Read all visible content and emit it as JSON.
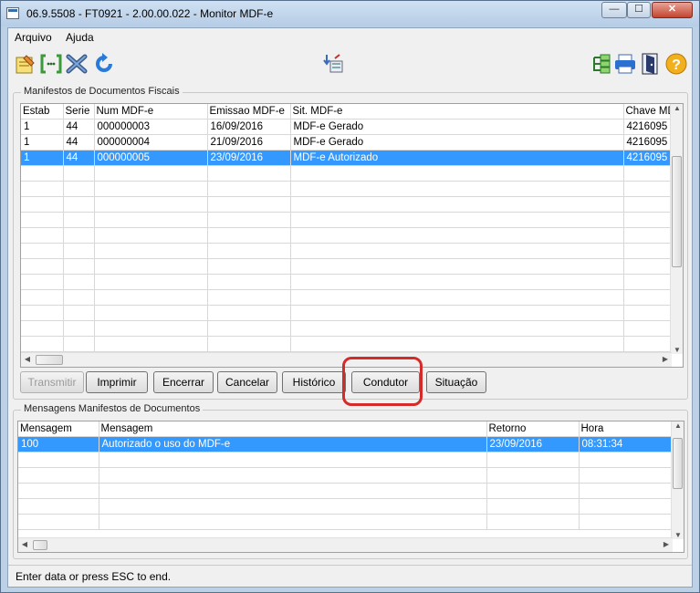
{
  "window": {
    "title": "06.9.5508 - FT0921 - 2.00.00.022 - Monitor MDF-e"
  },
  "titlebar_buttons": {
    "minimize": "—",
    "maximize": "☐",
    "close": "✕"
  },
  "menu": {
    "arquivo": "Arquivo",
    "ajuda": "Ajuda"
  },
  "toolbar": {
    "left": [
      "edit-document-icon",
      "select-bracket-icon",
      "close-x-icon",
      "refresh-icon"
    ],
    "center": [
      "transfer-icon"
    ],
    "right": [
      "tree-icon",
      "print-icon",
      "exit-door-icon",
      "help-icon"
    ]
  },
  "manifestos": {
    "legend": "Manifestos de Documentos Fiscais",
    "columns": [
      "Estab",
      "Serie",
      "Num MDF-e",
      "Emissao MDF-e",
      "Sit. MDF-e",
      "Chave MDF"
    ],
    "rows": [
      [
        "1",
        "44",
        "000000003",
        "16/09/2016",
        "MDF-e Gerado",
        "4216095"
      ],
      [
        "1",
        "44",
        "000000004",
        "21/09/2016",
        "MDF-e Gerado",
        "4216095"
      ],
      [
        "1",
        "44",
        "000000005",
        "23/09/2016",
        "MDF-e Autorizado",
        "4216095"
      ]
    ],
    "selected_row": 2
  },
  "actions": {
    "transmitir": "Transmitir",
    "imprimir": "Imprimir",
    "encerrar": "Encerrar",
    "cancelar": "Cancelar",
    "historico": "Histórico",
    "condutor": "Condutor",
    "situacao": "Situação"
  },
  "mensagens": {
    "legend": "Mensagens Manifestos de Documentos",
    "columns": [
      "Mensagem",
      "Mensagem",
      "Retorno",
      "Hora"
    ],
    "rows": [
      [
        "100",
        "Autorizado o uso do MDF-e",
        "23/09/2016",
        "08:31:34"
      ]
    ],
    "selected_row": 0
  },
  "status": {
    "text": "Enter data or press ESC to end."
  },
  "colors": {
    "selection": "#3399ff",
    "highlight_ring": "#d42a2a"
  }
}
